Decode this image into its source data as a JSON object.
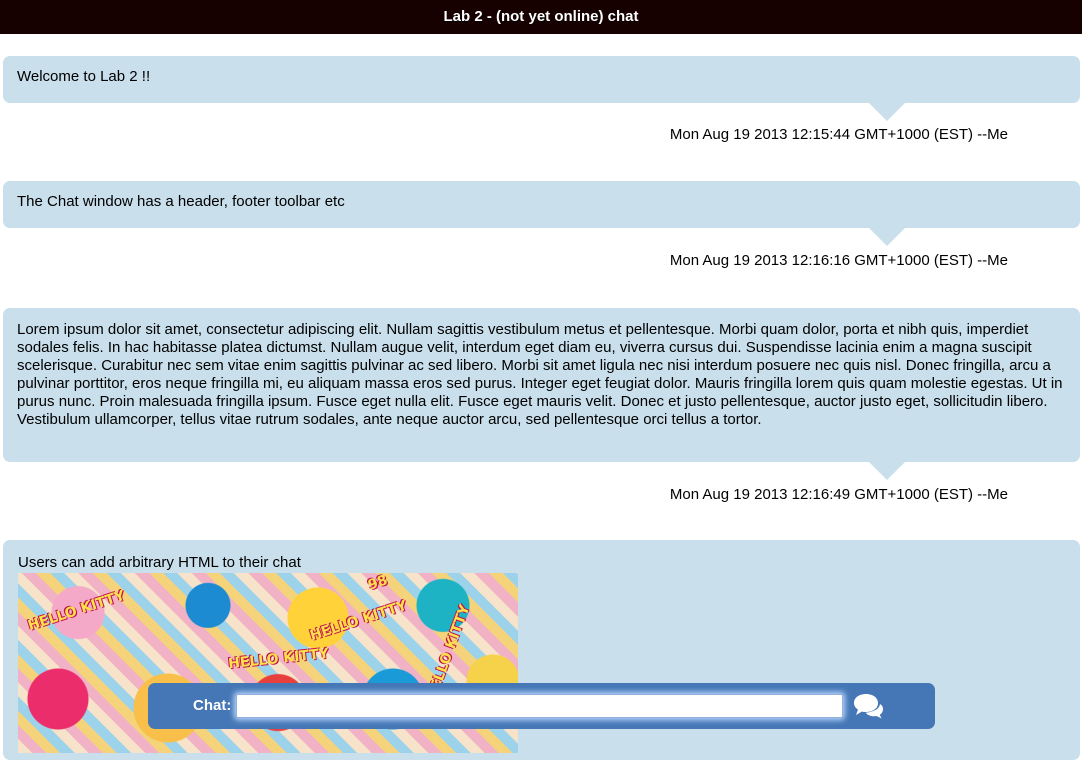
{
  "header": {
    "title": "Lab 2 - (not yet online) chat"
  },
  "messages": [
    {
      "text": "Welcome to Lab 2 !!",
      "meta": "Mon Aug 19 2013 12:15:44 GMT+1000 (EST) --Me"
    },
    {
      "text": "The Chat window has a header, footer toolbar etc",
      "meta": "Mon Aug 19 2013 12:16:16 GMT+1000 (EST) --Me"
    },
    {
      "text": "Lorem ipsum dolor sit amet, consectetur adipiscing elit. Nullam sagittis vestibulum metus et pellentesque. Morbi quam dolor, porta et nibh quis, imperdiet sodales felis. In hac habitasse platea dictumst. Nullam augue velit, interdum eget diam eu, viverra cursus dui. Suspendisse lacinia enim a magna suscipit scelerisque. Curabitur nec sem vitae enim sagittis pulvinar ac sed libero. Morbi sit amet ligula nec nisi interdum posuere nec quis nisl. Donec fringilla, arcu a pulvinar porttitor, eros neque fringilla mi, eu aliquam massa eros sed purus. Integer eget feugiat dolor. Mauris fringilla lorem quis quam molestie egestas. Ut in purus nunc. Proin malesuada fringilla ipsum. Fusce eget nulla elit. Fusce eget mauris velit. Donec et justo pellentesque, auctor justo eget, sollicitudin libero. Vestibulum ullamcorper, tellus vitae rutrum sodales, ante neque auctor arcu, sed pellentesque orci tellus a tortor.",
      "meta": "Mon Aug 19 2013 12:16:49 GMT+1000 (EST) --Me"
    },
    {
      "text": "Users can add arbitrary HTML to their chat",
      "image_stickers": [
        "HELLO KITTY",
        "HELLO KITTY",
        "98",
        "HELLO KITTY",
        "HELLO KITTY"
      ]
    }
  ],
  "footer": {
    "chat_label": "Chat:",
    "chat_value": "",
    "chat_placeholder": "",
    "send_icon": "comments-icon"
  },
  "colors": {
    "header_bg": "#170000",
    "bubble_bg": "#c9dfec",
    "footer_bg": "#4577b6"
  }
}
